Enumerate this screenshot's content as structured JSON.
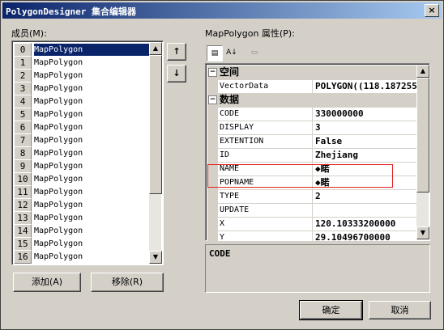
{
  "window": {
    "title": "PolygonDesigner 集合编辑器",
    "close": "×"
  },
  "members_label": "成员(M):",
  "members": [
    {
      "index": "0",
      "name": "MapPolygon",
      "selected": true
    },
    {
      "index": "1",
      "name": "MapPolygon"
    },
    {
      "index": "2",
      "name": "MapPolygon"
    },
    {
      "index": "3",
      "name": "MapPolygon"
    },
    {
      "index": "4",
      "name": "MapPolygon"
    },
    {
      "index": "5",
      "name": "MapPolygon"
    },
    {
      "index": "6",
      "name": "MapPolygon"
    },
    {
      "index": "7",
      "name": "MapPolygon"
    },
    {
      "index": "8",
      "name": "MapPolygon"
    },
    {
      "index": "9",
      "name": "MapPolygon"
    },
    {
      "index": "10",
      "name": "MapPolygon"
    },
    {
      "index": "11",
      "name": "MapPolygon"
    },
    {
      "index": "12",
      "name": "MapPolygon"
    },
    {
      "index": "13",
      "name": "MapPolygon"
    },
    {
      "index": "14",
      "name": "MapPolygon"
    },
    {
      "index": "15",
      "name": "MapPolygon"
    },
    {
      "index": "16",
      "name": "MapPolygon"
    }
  ],
  "move_up": "↑",
  "move_down": "↓",
  "add_button": "添加(A)",
  "remove_button": "移除(R)",
  "props_label": "MapPolygon 属性(P):",
  "toolbar": {
    "categorized": "▤",
    "alphabetical": "A↓",
    "pages": "▭"
  },
  "categories": [
    {
      "name": "空间",
      "expander": "−",
      "rows": [
        {
          "name": "VectorData",
          "value": "POLYGON((118.187255"
        }
      ]
    },
    {
      "name": "数据",
      "expander": "−",
      "rows": [
        {
          "name": "CODE",
          "value": "330000000"
        },
        {
          "name": "DISPLAY",
          "value": "3"
        },
        {
          "name": "EXTENTION",
          "value": "False"
        },
        {
          "name": "ID",
          "value": "Zhejiang"
        },
        {
          "name": "NAME",
          "value": "◆睰"
        },
        {
          "name": "POPNAME",
          "value": "◆睰"
        },
        {
          "name": "TYPE",
          "value": "2"
        },
        {
          "name": "UPDATE",
          "value": ""
        },
        {
          "name": "X",
          "value": "120.10333200000"
        },
        {
          "name": "Y",
          "value": "29.10496700000"
        }
      ]
    }
  ],
  "description": "CODE",
  "ok_button": "确定",
  "cancel_button": "取消",
  "scroll_up": "▲",
  "scroll_down": "▼"
}
